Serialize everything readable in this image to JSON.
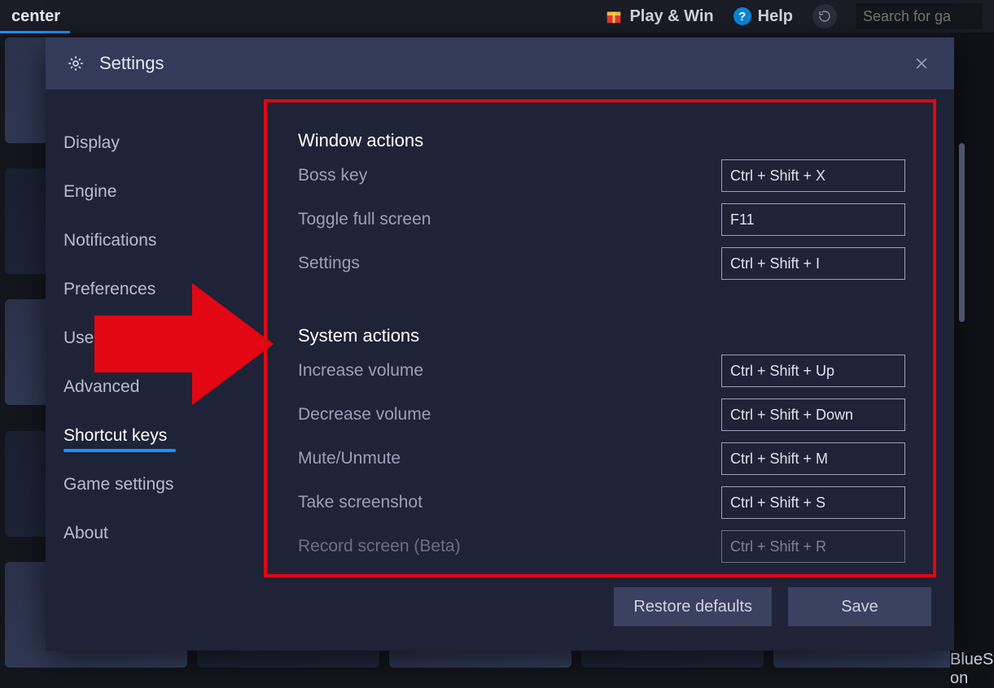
{
  "topbar": {
    "left_fragment": "center",
    "play_win": "Play & Win",
    "help": "Help",
    "search_placeholder": "Search for ga"
  },
  "bottom_right_caption": "BlueStacks on",
  "modal": {
    "title": "Settings"
  },
  "sidebar": {
    "items": [
      {
        "label": "Display",
        "active": false
      },
      {
        "label": "Engine",
        "active": false
      },
      {
        "label": "Notifications",
        "active": false
      },
      {
        "label": "Preferences",
        "active": false
      },
      {
        "label": "User",
        "active": false
      },
      {
        "label": "Advanced",
        "active": false
      },
      {
        "label": "Shortcut keys",
        "active": true
      },
      {
        "label": "Game settings",
        "active": false
      },
      {
        "label": "About",
        "active": false
      }
    ]
  },
  "content": {
    "section1_title": "Window actions",
    "section2_title": "System actions",
    "rows1": [
      {
        "label": "Boss key",
        "shortcut": "Ctrl + Shift + X"
      },
      {
        "label": "Toggle full screen",
        "shortcut": "F11"
      },
      {
        "label": "Settings",
        "shortcut": "Ctrl + Shift + I"
      }
    ],
    "rows2": [
      {
        "label": "Increase volume",
        "shortcut": "Ctrl + Shift + Up"
      },
      {
        "label": "Decrease volume",
        "shortcut": "Ctrl + Shift + Down"
      },
      {
        "label": "Mute/Unmute",
        "shortcut": "Ctrl + Shift + M"
      },
      {
        "label": "Take screenshot",
        "shortcut": "Ctrl + Shift + S"
      },
      {
        "label": "Record screen (Beta)",
        "shortcut": "Ctrl + Shift + R",
        "dim": true
      }
    ]
  },
  "footer": {
    "restore": "Restore defaults",
    "save": "Save"
  }
}
